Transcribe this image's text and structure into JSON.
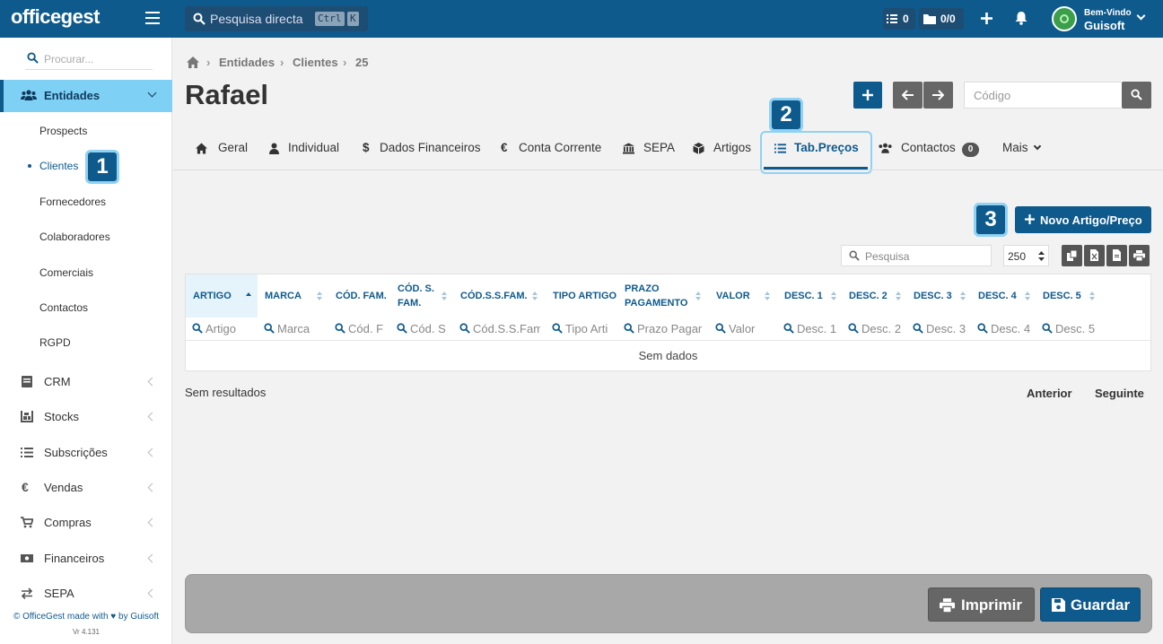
{
  "brand": {
    "logo": "officegest"
  },
  "topbar": {
    "search_label": "Pesquisa directa",
    "shortcut_ctrl": "Ctrl",
    "shortcut_k": "K",
    "tasks_count": "0",
    "folders_count": "0/0",
    "welcome": "Bem-Vindo",
    "user": "Guisoft"
  },
  "sidebar": {
    "search_placeholder": "Procurar...",
    "active_label": "Entidades",
    "submenu": [
      "Prospects",
      "Clientes",
      "Fornecedores",
      "Colaboradores",
      "Comerciais",
      "Contactos",
      "RGPD"
    ],
    "modules": [
      "CRM",
      "Stocks",
      "Subscrições",
      "Vendas",
      "Compras",
      "Financeiros",
      "SEPA"
    ],
    "footer_line1": "© OfficeGest made with ♥ by Guisoft",
    "footer_version": "Vr 4.131"
  },
  "breadcrumb": {
    "entidades": "Entidades",
    "clientes": "Clientes",
    "id": "25"
  },
  "page": {
    "title": "Rafael",
    "codigo_placeholder": "Código"
  },
  "tabs": {
    "geral": "Geral",
    "individual": "Individual",
    "dados": "Dados Financeiros",
    "conta": "Conta Corrente",
    "sepa": "SEPA",
    "artigos": "Artigos",
    "tabprecos": "Tab.Preços",
    "contactos": "Contactos",
    "contactos_badge": "0",
    "mais": "Mais"
  },
  "callouts": {
    "one": "1",
    "two": "2",
    "three": "3"
  },
  "toolbar": {
    "new_button": "Novo Artigo/Preço",
    "search_placeholder": "Pesquisa",
    "page_size": "250"
  },
  "table": {
    "headers": {
      "c0": "ARTIGO",
      "c1": "MARCA",
      "c2": "CÓD. FAM.",
      "c3a": "CÓD. S.",
      "c3b": "FAM.",
      "c4": "CÓD.S.S.FAM.",
      "c5": "TIPO ARTIGO",
      "c6a": "PRAZO",
      "c6b": "PAGAMENTO",
      "c7": "VALOR",
      "c8": "DESC. 1",
      "c9": "DESC. 2",
      "c10": "DESC. 3",
      "c11": "DESC. 4",
      "c12": "DESC. 5"
    },
    "filters": {
      "c0": "Artigo",
      "c1": "Marca",
      "c2": "Cód. F",
      "c3": "Cód. S",
      "c4": "Cód.S.S.Fam",
      "c5": "Tipo Arti",
      "c6": "Prazo Pagar",
      "c7": "Valor",
      "c8": "Desc. 1",
      "c9": "Desc. 2",
      "c10": "Desc. 3",
      "c11": "Desc. 4",
      "c12": "Desc. 5"
    },
    "empty": "Sem dados"
  },
  "results": {
    "text": "Sem resultados",
    "prev": "Anterior",
    "next": "Seguinte"
  },
  "actions": {
    "print": "Imprimir",
    "save": "Guardar"
  }
}
